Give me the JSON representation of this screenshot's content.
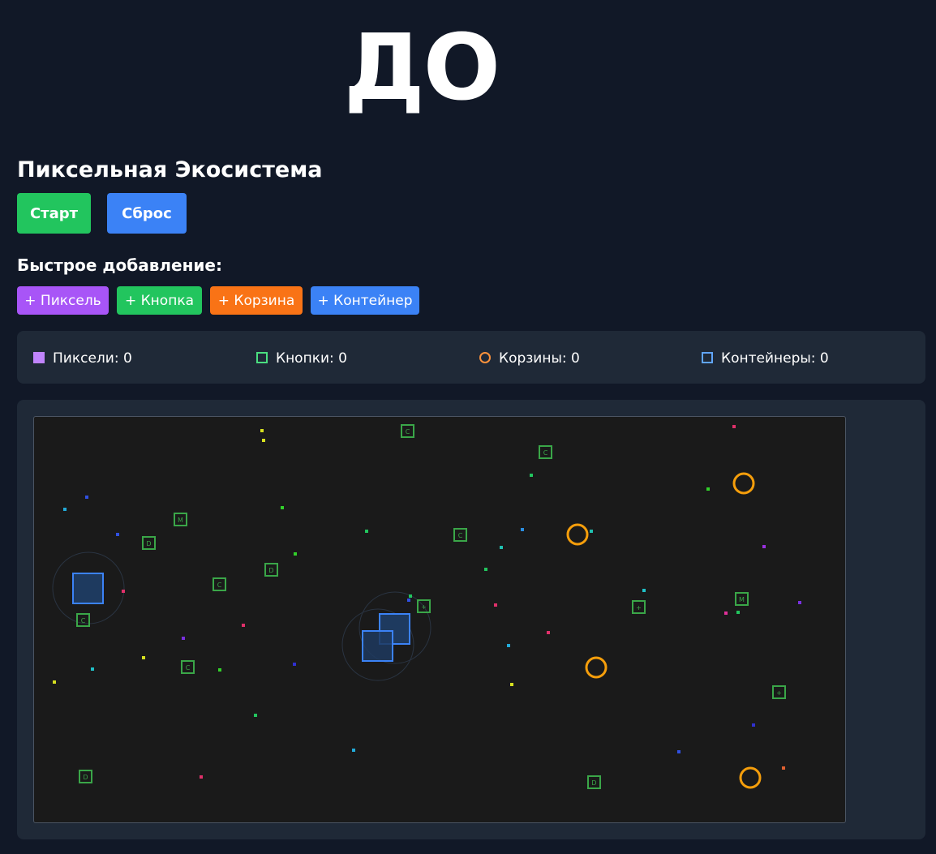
{
  "header": {
    "big_label": "ДО"
  },
  "app": {
    "title": "Пиксельная Экосистема"
  },
  "controls": {
    "start_label": "Старт",
    "reset_label": "Сброс"
  },
  "quick_add": {
    "title": "Быстрое добавление:",
    "pixel_label": "+ Пиксель",
    "button_label": "+ Кнопка",
    "basket_label": "+ Корзина",
    "container_label": "+ Контейнер"
  },
  "stats": {
    "pixels": "Пиксели: 0",
    "buttons": "Кнопки: 0",
    "baskets": "Корзины: 0",
    "containers": "Контейнеры: 0"
  },
  "colors": {
    "background": "#111827",
    "panel": "#1f2937",
    "canvas": "#1a1a1a",
    "pixel": "#a855f7",
    "button": "#22c55e",
    "basket": "#f97316",
    "container": "#3b82f6"
  },
  "field": {
    "button_labels": [
      "C",
      "C",
      "M",
      "D",
      "C",
      "D",
      "C",
      "+",
      "+",
      "M",
      "C",
      "C",
      "+",
      "D",
      "D"
    ]
  }
}
